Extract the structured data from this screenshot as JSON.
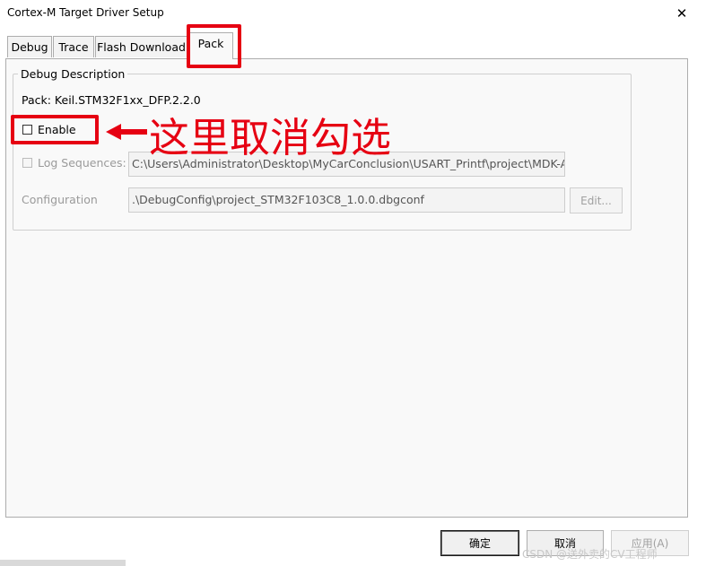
{
  "window": {
    "title": "Cortex-M Target Driver Setup",
    "close_symbol": "✕"
  },
  "tabs": [
    {
      "label": "Debug"
    },
    {
      "label": "Trace"
    },
    {
      "label": "Flash Download"
    },
    {
      "label": "Pack"
    }
  ],
  "active_tab": "Pack",
  "group": {
    "legend": "Debug Description",
    "pack_line": "Pack:  Keil.STM32F1xx_DFP.2.2.0",
    "enable_label": "Enable",
    "enable_checked": false,
    "log_sequences_label": "Log Sequences:",
    "log_sequences_checked": false,
    "log_path": "C:\\Users\\Administrator\\Desktop\\MyCarConclusion\\USART_Printf\\project\\MDK-ARM",
    "configuration_label": "Configuration",
    "configuration_value": ".\\DebugConfig\\project_STM32F103C8_1.0.0.dbgconf",
    "edit_button": "Edit..."
  },
  "buttons": {
    "ok": "确定",
    "cancel": "取消",
    "apply": "应用(A)"
  },
  "annotation": {
    "text": "这里取消勾选",
    "color": "#e60012"
  },
  "watermark": "CSDN @送外卖的CV工程师"
}
